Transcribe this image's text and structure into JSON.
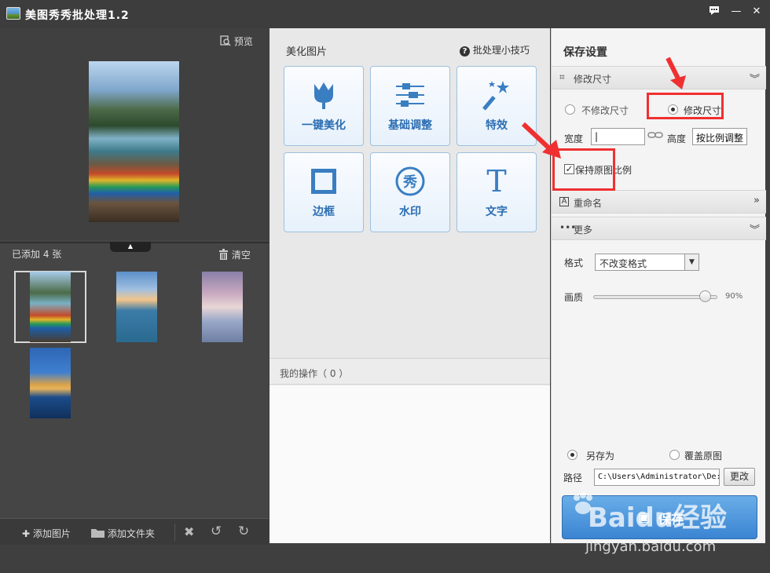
{
  "titlebar": {
    "title": "美图秀秀批处理1.2",
    "feedback_icon": "chat-icon",
    "minimize": "—",
    "close": "✕"
  },
  "left": {
    "preview_label": "预览",
    "added_count": "已添加 4 张",
    "clear_label": "清空",
    "bottom": {
      "add_image": "添加图片",
      "add_folder": "添加文件夹"
    }
  },
  "middle": {
    "title": "美化图片",
    "tips": "批处理小技巧",
    "tools": [
      {
        "label": "一键美化",
        "icon": "tulip-icon"
      },
      {
        "label": "基础调整",
        "icon": "sliders-icon"
      },
      {
        "label": "特效",
        "icon": "magic-wand-icon"
      },
      {
        "label": "边框",
        "icon": "frame-icon"
      },
      {
        "label": "水印",
        "icon": "watermark-icon"
      },
      {
        "label": "文字",
        "icon": "text-icon"
      }
    ],
    "ops_label": "我的操作（ 0 ）"
  },
  "right": {
    "title": "保存设置",
    "resize_section": "修改尺寸",
    "no_resize": "不修改尺寸",
    "resize": "修改尺寸",
    "width_label": "宽度",
    "width_value": "|",
    "height_label": "高度",
    "height_value": "按比例调整",
    "keep_ratio": "保持原图比例",
    "rename_section": "重命名",
    "more_section": "更多",
    "format_label": "格式",
    "format_value": "不改变格式",
    "quality_label": "画质",
    "quality_value": "90%",
    "quality_fraction": 0.9,
    "save_as": "另存为",
    "overwrite": "覆盖原图",
    "path_label": "路径",
    "path_value": "C:\\Users\\Administrator\\De:",
    "change_btn": "更改",
    "save_btn": "保存"
  },
  "watermark": {
    "brand": "Baidu经验",
    "url": "jingyan.baidu.com"
  },
  "colors": {
    "accent": "#3a84d2",
    "highlight": "#f03030"
  }
}
